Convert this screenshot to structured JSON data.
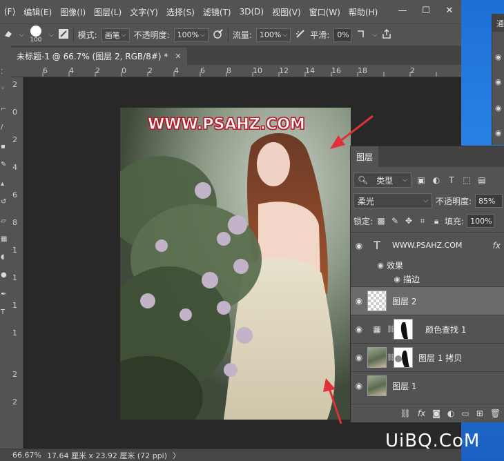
{
  "menu": {
    "items": [
      "(F)",
      "编辑(E)",
      "图像(I)",
      "图层(L)",
      "文字(Y)",
      "选择(S)",
      "滤镜(T)",
      "3D(D)",
      "视图(V)",
      "窗口(W)",
      "帮助(H)"
    ]
  },
  "window_controls": {
    "minimize": "—",
    "maximize": "☐",
    "close": "✕"
  },
  "options": {
    "brush_size": "100",
    "mode_label": "模式:",
    "mode_value": "画笔",
    "opacity_label": "不透明度:",
    "opacity_value": "100%",
    "flow_label": "流量:",
    "flow_value": "100%",
    "smooth_label": "平滑:",
    "smooth_value": "0%"
  },
  "document": {
    "tab_title": "未标题-1 @ 66.7% (图层 2, RGB/8#) *",
    "close": "✕"
  },
  "ruler_top": [
    "6",
    "4",
    "2",
    "0",
    "2",
    "4",
    "6",
    "8",
    "10",
    "12",
    "14",
    "16",
    "18",
    "2"
  ],
  "ruler_left": [
    "2",
    "0",
    "2",
    "4",
    "6",
    "8",
    "1",
    "1",
    "1",
    "1",
    "2",
    "2"
  ],
  "canvas": {
    "watermark_text": "WWW.PSAHZ.COM"
  },
  "status": {
    "zoom": "66.67%",
    "doc_size": "17.64 厘米 x 23.92 厘米 (72 ppi)",
    "arrow": "〉"
  },
  "side_panel": {
    "tab": "通"
  },
  "layers": {
    "tab_label": "图层",
    "filter_label": "类型",
    "blend_mode": "柔光",
    "opacity_label": "不透明度:",
    "opacity_value": "85%",
    "lock_label": "锁定:",
    "fill_label": "填充:",
    "fill_value": "100%",
    "text_layer_name": "WWW.PSAHZ.COM",
    "fx_label": "fx",
    "effects_label": "效果",
    "stroke_label": "描边",
    "items": [
      {
        "name": "图层 2"
      },
      {
        "name": "颜色查找 1"
      },
      {
        "name": "图层 1 拷贝"
      },
      {
        "name": "图层 1"
      }
    ]
  },
  "site_logo": "UiBQ.CoM",
  "colors": {
    "panel": "#535353",
    "canvas": "#282828",
    "watermark": "#c0182a",
    "arrow": "#e0303a"
  }
}
